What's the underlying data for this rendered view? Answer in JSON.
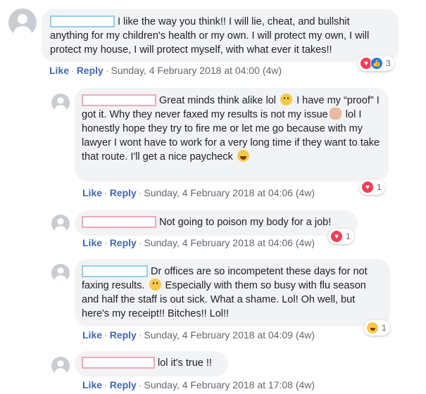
{
  "comments": [
    {
      "text": "I like the way you think!! I will lie, cheat, and bullshit anything for my children's health or my own. I will protect my own, I will protect my house, I will protect myself, with what ever it takes!!",
      "like": "Like",
      "reply": "Reply",
      "time": "Sunday, 4 February 2018 at 04:00 (4w)",
      "reaction_count": "3",
      "reactions": [
        "love",
        "like"
      ]
    },
    {
      "text_1": "Great minds think alike lol",
      "text_2": "I have my “proof” I got it. Why they never faxed my results is not my issue",
      "text_3": "lol I honestly hope they try to fire me or let me go because with my lawyer I wont have to work for a very long time if they want to take that route. I'll get a nice paycheck",
      "like": "Like",
      "reply": "Reply",
      "time": "Sunday, 4 February 2018 at 04:06 (4w)",
      "reaction_count": "1",
      "reactions": [
        "love"
      ]
    },
    {
      "text": "Not going to poison my body for a job!",
      "like": "Like",
      "reply": "Reply",
      "time": "Sunday, 4 February 2018 at 04:06 (4w)",
      "reaction_count": "1",
      "reactions": [
        "love"
      ]
    },
    {
      "text_1": "Dr offices are so incompetent these days for not faxing results.",
      "text_2": "Especially with them so busy with flu season and half the staff is out sick. What a shame. Lol! Oh well, but here's my receipt!! Bitches!! Lol!!",
      "like": "Like",
      "reply": "Reply",
      "time": "Sunday, 4 February 2018 at 04:09 (4w)",
      "reaction_count": "1",
      "reactions": [
        "haha"
      ]
    },
    {
      "text": "lol it's true !!",
      "like": "Like",
      "reply": "Reply",
      "time": "Sunday, 4 February 2018 at 17:08 (4w)"
    }
  ],
  "separator": "·",
  "colors": {
    "bubble": "#f2f3f5",
    "link": "#4267b2",
    "meta": "#616770",
    "redact_blue": "#8fd0ec",
    "redact_pink": "#f0a9bc"
  }
}
